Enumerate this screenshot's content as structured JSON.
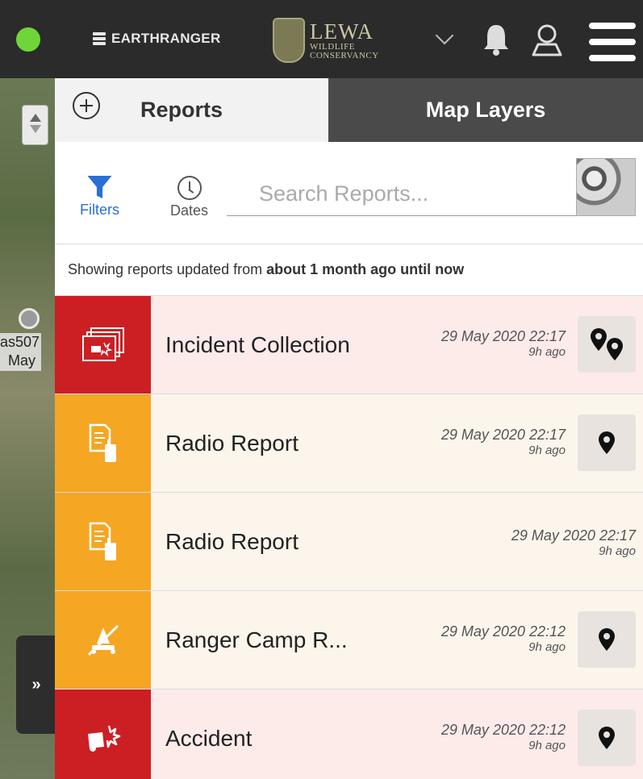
{
  "header": {
    "brand": "EARTHRANGER",
    "org_name": "LEWA",
    "org_subtitle_line1": "WILDLIFE",
    "org_subtitle_line2": "CONSERVANCY"
  },
  "map": {
    "label_line1": "as507",
    "label_line2": "May"
  },
  "tabs": {
    "reports": "Reports",
    "map_layers": "Map Layers"
  },
  "filterbar": {
    "filters_label": "Filters",
    "dates_label": "Dates",
    "search_placeholder": "Search Reports..."
  },
  "showing": {
    "prefix": "Showing reports updated from",
    "range": "about 1 month ago until now"
  },
  "reports": [
    {
      "title": "Incident Collection",
      "date": "29 May 2020 22:17",
      "ago": "9h ago",
      "color": "#cc1f24",
      "icon": "incident-collection-icon",
      "location": "multi"
    },
    {
      "title": "Radio Report",
      "date": "29 May 2020 22:17",
      "ago": "9h ago",
      "color": "#f5a623",
      "icon": "radio-report-icon",
      "location": "single"
    },
    {
      "title": "Radio Report",
      "date": "29 May 2020 22:17",
      "ago": "9h ago",
      "color": "#f5a623",
      "icon": "radio-report-icon",
      "location": "none"
    },
    {
      "title": "Ranger Camp R...",
      "date": "29 May 2020 22:12",
      "ago": "9h ago",
      "color": "#f5a623",
      "icon": "ranger-camp-icon",
      "location": "single"
    },
    {
      "title": "Accident",
      "date": "29 May 2020 22:12",
      "ago": "9h ago",
      "color": "#cc1f24",
      "icon": "accident-icon",
      "location": "single"
    }
  ]
}
